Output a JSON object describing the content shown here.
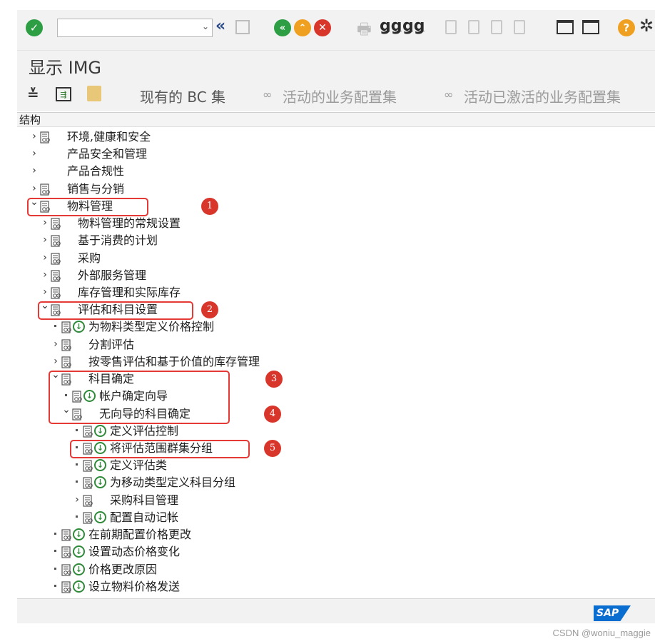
{
  "window": {
    "title": "显示 IMG",
    "command_field": {
      "value": "",
      "placeholder": ""
    }
  },
  "toolbar": {
    "icons": [
      "enter-icon",
      "back-icon",
      "save-icon",
      "nav-back-icon",
      "nav-exit-icon",
      "nav-cancel-icon",
      "print-icon",
      "find-icon",
      "find-next-icon",
      "first-page-icon",
      "prev-page-icon",
      "next-page-icon",
      "last-page-icon",
      "new-session-icon",
      "shortcut-icon",
      "help-icon",
      "settings-icon"
    ]
  },
  "app_toolbar": {
    "items": [
      {
        "label": "现有的 BC 集",
        "state": "active"
      },
      {
        "label": "活动的业务配置集",
        "state": "inactive"
      },
      {
        "label": "活动已激活的业务配置集",
        "state": "inactive"
      }
    ]
  },
  "tree": {
    "header": "结构",
    "nodes": [
      {
        "label": "环境,健康和安全",
        "level": 0,
        "state": "collapsed",
        "doc": true,
        "exec": false
      },
      {
        "label": "产品安全和管理",
        "level": 0,
        "state": "collapsed",
        "doc": false,
        "exec": false
      },
      {
        "label": "产品合规性",
        "level": 0,
        "state": "collapsed",
        "doc": false,
        "exec": false
      },
      {
        "label": "销售与分销",
        "level": 0,
        "state": "collapsed",
        "doc": true,
        "exec": false
      },
      {
        "label": "物料管理",
        "level": 0,
        "state": "expanded",
        "doc": true,
        "exec": false
      },
      {
        "label": "物料管理的常规设置",
        "level": 1,
        "state": "collapsed",
        "doc": true,
        "exec": false
      },
      {
        "label": "基于消费的计划",
        "level": 1,
        "state": "collapsed",
        "doc": true,
        "exec": false
      },
      {
        "label": "采购",
        "level": 1,
        "state": "collapsed",
        "doc": true,
        "exec": false
      },
      {
        "label": "外部服务管理",
        "level": 1,
        "state": "collapsed",
        "doc": true,
        "exec": false
      },
      {
        "label": "库存管理和实际库存",
        "level": 1,
        "state": "collapsed",
        "doc": true,
        "exec": false
      },
      {
        "label": "评估和科目设置",
        "level": 1,
        "state": "expanded",
        "doc": true,
        "exec": false
      },
      {
        "label": "为物料类型定义价格控制",
        "level": 2,
        "state": "leaf",
        "doc": true,
        "exec": true
      },
      {
        "label": "分割评估",
        "level": 2,
        "state": "collapsed",
        "doc": true,
        "exec": false
      },
      {
        "label": "按零售评估和基于价值的库存管理",
        "level": 2,
        "state": "collapsed",
        "doc": true,
        "exec": false
      },
      {
        "label": "科目确定",
        "level": 2,
        "state": "expanded",
        "doc": true,
        "exec": false
      },
      {
        "label": "帐户确定向导",
        "level": 3,
        "state": "leaf",
        "doc": true,
        "exec": true
      },
      {
        "label": "无向导的科目确定",
        "level": 3,
        "state": "expanded",
        "doc": true,
        "exec": false
      },
      {
        "label": "定义评估控制",
        "level": 4,
        "state": "leaf",
        "doc": true,
        "exec": true
      },
      {
        "label": "将评估范围群集分组",
        "level": 4,
        "state": "leaf",
        "doc": true,
        "exec": true
      },
      {
        "label": "定义评估类",
        "level": 4,
        "state": "leaf",
        "doc": true,
        "exec": true
      },
      {
        "label": "为移动类型定义科目分组",
        "level": 4,
        "state": "leaf",
        "doc": true,
        "exec": true
      },
      {
        "label": "采购科目管理",
        "level": 4,
        "state": "collapsed",
        "doc": true,
        "exec": false
      },
      {
        "label": "配置自动记帐",
        "level": 4,
        "state": "leaf",
        "doc": true,
        "exec": true
      },
      {
        "label": "在前期配置价格更改",
        "level": 2,
        "state": "leaf",
        "doc": true,
        "exec": true
      },
      {
        "label": "设置动态价格变化",
        "level": 2,
        "state": "leaf",
        "doc": true,
        "exec": true
      },
      {
        "label": "价格更改原因",
        "level": 2,
        "state": "leaf",
        "doc": true,
        "exec": true
      },
      {
        "label": "设立物料价格发送",
        "level": 2,
        "state": "leaf",
        "doc": true,
        "exec": true
      }
    ]
  },
  "annotations": [
    {
      "number": "1",
      "target": "物料管理"
    },
    {
      "number": "2",
      "target": "评估和科目设置"
    },
    {
      "number": "3",
      "target": "科目确定"
    },
    {
      "number": "4",
      "target": "无向导的科目确定"
    },
    {
      "number": "5",
      "target": "将评估范围群集分组"
    }
  ],
  "status_bar": {
    "logo": "SAP"
  },
  "watermark": "CSDN @woniu_maggie",
  "colors": {
    "toolbar_bg": "#f2f2f2",
    "highlight_red": "#e53935",
    "badge_red": "#d9362b",
    "exec_green": "#2f8a3a",
    "sap_blue": "#0a6ed1",
    "nav_green": "#2e9e44",
    "nav_orange": "#f0a020",
    "nav_red": "#d9362b"
  }
}
